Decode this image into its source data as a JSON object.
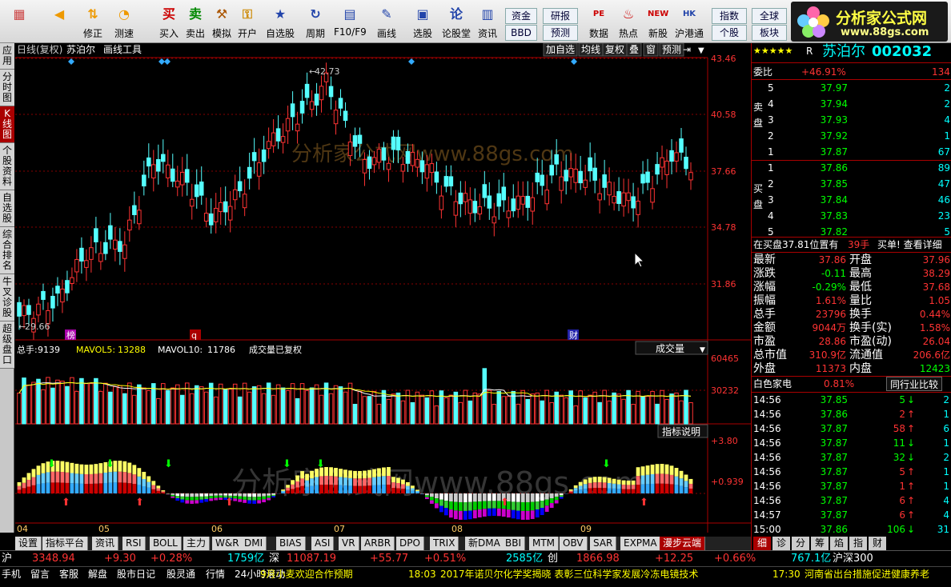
{
  "toolbar": {
    "buttons": [
      {
        "label": "",
        "icon": "grid-icon",
        "glyph": "▦",
        "color": "#c44"
      },
      {
        "label": "",
        "icon": "back-arrow-icon",
        "glyph": "◀",
        "color": "#e90"
      },
      {
        "label": "修正",
        "icon": "up-down-arrow-icon",
        "glyph": "⇅",
        "color": "#e90"
      },
      {
        "label": "测速",
        "icon": "speed-icon",
        "glyph": "◔",
        "color": "#e90"
      },
      {
        "label": "测速",
        "icon": "clock-icon",
        "glyph": "◷",
        "color": "#c60"
      },
      {
        "label": "买入",
        "icon": "buy-icon",
        "glyph": "买",
        "color": "#c00"
      },
      {
        "label": "卖出",
        "icon": "sell-icon",
        "glyph": "卖",
        "color": "#080"
      },
      {
        "label": "模拟",
        "icon": "hammer-icon",
        "glyph": "⚒",
        "color": "#a50"
      },
      {
        "label": "开户",
        "icon": "lock-icon",
        "glyph": "⚿",
        "color": "#c80"
      },
      {
        "label": "自选股",
        "icon": "star-icon",
        "glyph": "★",
        "color": "#24a"
      },
      {
        "label": "周期",
        "icon": "cycle-icon",
        "glyph": "↻",
        "color": "#24a"
      },
      {
        "label": "F10/F9",
        "icon": "f10-icon",
        "glyph": "▤",
        "color": "#24a"
      },
      {
        "label": "画线",
        "icon": "pencil-icon",
        "glyph": "✎",
        "color": "#24a"
      },
      {
        "label": "选股",
        "icon": "select-icon",
        "glyph": "▣",
        "color": "#24a"
      },
      {
        "label": "论股堂",
        "icon": "discuss-icon",
        "glyph": "论",
        "color": "#24a"
      },
      {
        "label": "资讯",
        "icon": "news-icon",
        "glyph": "▥",
        "color": "#24a"
      },
      {
        "label": "数据",
        "icon": "pe-icon",
        "glyph": "PE",
        "color": "#c00"
      },
      {
        "label": "热点",
        "icon": "hot-icon",
        "glyph": "♨",
        "color": "#c00"
      },
      {
        "label": "新股",
        "icon": "new-stock-icon",
        "glyph": "NEW",
        "color": "#c00"
      },
      {
        "label": "沪港通",
        "icon": "hk-icon",
        "glyph": "HK",
        "color": "#24a"
      }
    ],
    "small": [
      "资金",
      "BBD",
      "研报",
      "预测",
      "指数",
      "个股",
      "全球",
      "板块"
    ],
    "logo1": "分析家公式网",
    "logo2": "www.88gs.com"
  },
  "leftbar": [
    "应用",
    "分时图",
    "K线图",
    "个股资料",
    "自选股",
    "综合排名",
    "牛叉诊股",
    "超级盘口"
  ],
  "chart": {
    "top_labels": [
      "日线(复权)",
      "苏泊尔",
      "画线工具"
    ],
    "top_buttons": [
      "加自选",
      "均线",
      "复权",
      "叠",
      "窗",
      "预测"
    ],
    "price_ticks": [
      "43.46",
      "40.58",
      "37.66",
      "34.78",
      "31.86"
    ],
    "high": "42.73",
    "low": "29.66",
    "markers": [
      "榜",
      "q",
      "财"
    ],
    "watermark1": "分析家公式网www.88gs.com",
    "watermark2": "分析家公式网www.88gs.com",
    "vol_info": {
      "label": "总手:",
      "val": "9139",
      "ma5_label": "MAVOL5:",
      "ma5": "13288",
      "ma10_label": "MAVOL10:",
      "ma10": "11786",
      "note": "成交量已复权",
      "dropdown": "成交量"
    },
    "vol_ticks": [
      "60465",
      "30232"
    ],
    "ind_ticks": [
      "+3.80",
      "+0.939"
    ],
    "ind_btn": "指标说明",
    "months": [
      "04",
      "05",
      "06",
      "07",
      "08",
      "09"
    ]
  },
  "tabs": [
    "设置",
    "指标平台",
    "资讯",
    "RSI",
    "BOLL",
    "主力",
    "W&R",
    "DMI",
    "BIAS",
    "ASI",
    "VR",
    "ARBR",
    "DPO",
    "TRIX",
    "新DMA",
    "BBI",
    "MTM",
    "OBV",
    "SAR",
    "EXPMA",
    "漫步云端"
  ],
  "right": {
    "name": "苏泊尔",
    "code": "002032",
    "weibi_label": "委比",
    "weibi": "+46.91%",
    "weibi_n": "134",
    "sell_label": "卖盘",
    "sell": [
      [
        "5",
        "37.97",
        "2"
      ],
      [
        "4",
        "37.94",
        "2"
      ],
      [
        "3",
        "37.93",
        "4"
      ],
      [
        "2",
        "37.92",
        "1"
      ],
      [
        "1",
        "37.87",
        "67"
      ]
    ],
    "buy_label": "买盘",
    "buy": [
      [
        "1",
        "37.86",
        "89"
      ],
      [
        "2",
        "37.85",
        "47"
      ],
      [
        "3",
        "37.84",
        "46"
      ],
      [
        "4",
        "37.83",
        "23"
      ],
      [
        "5",
        "37.82",
        "5"
      ]
    ],
    "info_line": "在买盘37.81位置有",
    "info_n": "39手",
    "info_tail": "买单! 查看详细",
    "quote": [
      [
        "最新",
        "37.86",
        "开盘",
        "37.96"
      ],
      [
        "涨跌",
        "-0.11",
        "最高",
        "38.29"
      ],
      [
        "涨幅",
        "-0.29%",
        "最低",
        "37.68"
      ],
      [
        "振幅",
        "1.61%",
        "量比",
        "1.05"
      ],
      [
        "总手",
        "23796",
        "换手",
        "0.44%"
      ],
      [
        "金额",
        "9044万",
        "换手(实)",
        "1.58%"
      ],
      [
        "市盈",
        "28.86",
        "市盈(动)",
        "26.04"
      ],
      [
        "总市值",
        "310.9亿",
        "流通值",
        "206.6亿"
      ],
      [
        "外盘",
        "11373",
        "内盘",
        "12423"
      ]
    ],
    "sector": "白色家电",
    "sector_pct": "0.81%",
    "compare": "同行业比较",
    "ticks": [
      [
        "14:56",
        "37.85",
        "5",
        "↓",
        "2"
      ],
      [
        "14:56",
        "37.86",
        "2",
        "↑",
        "1"
      ],
      [
        "14:56",
        "37.87",
        "58",
        "↑",
        "6"
      ],
      [
        "14:56",
        "37.87",
        "11",
        "↓",
        "1"
      ],
      [
        "14:56",
        "37.87",
        "32",
        "↓",
        "2"
      ],
      [
        "14:56",
        "37.87",
        "5",
        "↑",
        "1"
      ],
      [
        "14:56",
        "37.87",
        "1",
        "↑",
        "1"
      ],
      [
        "14:56",
        "37.87",
        "6",
        "↑",
        "4"
      ],
      [
        "14:57",
        "37.87",
        "6",
        "↑",
        "4"
      ],
      [
        "15:00",
        "37.86",
        "106",
        "↓",
        "31"
      ]
    ],
    "bottom_tabs": [
      "细",
      "诊",
      "分",
      "筹",
      "焰",
      "指",
      "财"
    ]
  },
  "status": {
    "sh": "沪",
    "sh_idx": "3348.94",
    "sh_chg": "+9.30",
    "sh_pct": "+0.28%",
    "sh_amt": "1759亿",
    "sz": "深",
    "sz_idx": "11087.19",
    "sz_chg": "+55.77",
    "sz_pct": "+0.51%",
    "sz_amt": "2585亿",
    "cy": "创",
    "cy_idx": "1866.98",
    "cy_chg": "+12.25",
    "cy_pct": "+0.66%",
    "cy_amt": "767.1亿",
    "hs": "沪深300"
  },
  "news": {
    "items": [
      "手机",
      "留言",
      "客服",
      "解盘",
      "股市日记",
      "股灵通",
      "行情",
      "24小时滚动"
    ],
    "headline1": "9月小麦欢迎合作预期",
    "time2": "18:03",
    "headline2": "2017年诺贝尔化学奖揭晓 表彰三位科学家发展冷冻电镜技术",
    "time3": "17:30",
    "headline3": "河南省出台措施促进健康养老"
  }
}
